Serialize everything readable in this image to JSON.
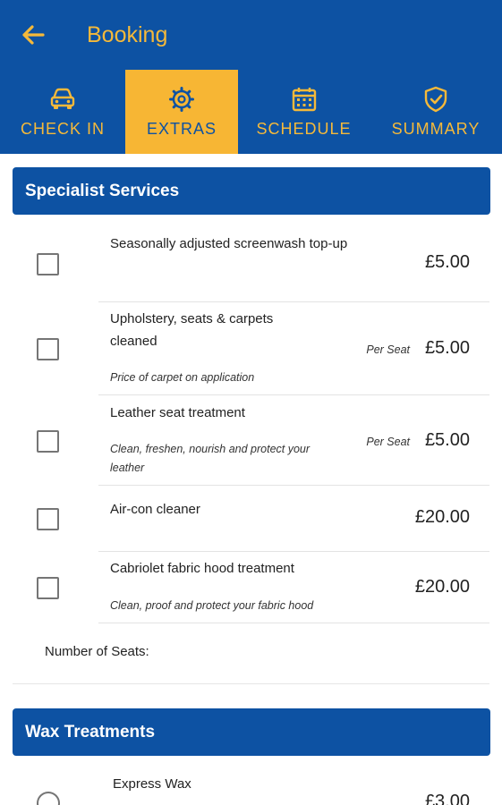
{
  "header": {
    "title": "Booking",
    "back_icon": "arrow-left-icon"
  },
  "colors": {
    "primary": "#0d52a3",
    "accent": "#f7b634"
  },
  "tabs": [
    {
      "label": "CHECK IN",
      "icon": "car-icon",
      "active": false
    },
    {
      "label": "EXTRAS",
      "icon": "gear-icon",
      "active": true
    },
    {
      "label": "SCHEDULE",
      "icon": "calendar-icon",
      "active": false
    },
    {
      "label": "SUMMARY",
      "icon": "shield-check-icon",
      "active": false
    }
  ],
  "specialist": {
    "title": "Specialist Services",
    "items": [
      {
        "name": "Seasonally adjusted screenwash top-up",
        "note": "",
        "per": "",
        "price": "£5.00",
        "checked": false
      },
      {
        "name": "Upholstery, seats & carpets cleaned",
        "note": "Price of carpet on application",
        "per": "Per Seat",
        "price": "£5.00",
        "checked": false
      },
      {
        "name": "Leather seat treatment",
        "note": "Clean, freshen, nourish and protect your leather",
        "per": "Per Seat",
        "price": "£5.00",
        "checked": false
      },
      {
        "name": "Air-con cleaner",
        "note": "",
        "per": "",
        "price": "£20.00",
        "checked": false
      },
      {
        "name": "Cabriolet fabric hood treatment",
        "note": "Clean, proof and protect your fabric hood",
        "per": "",
        "price": "£20.00",
        "checked": false
      }
    ],
    "seats_label": "Number of Seats:"
  },
  "wax": {
    "title": "Wax Treatments",
    "items": [
      {
        "name": "Express Wax",
        "price": "£3.00",
        "selected": false
      }
    ]
  }
}
